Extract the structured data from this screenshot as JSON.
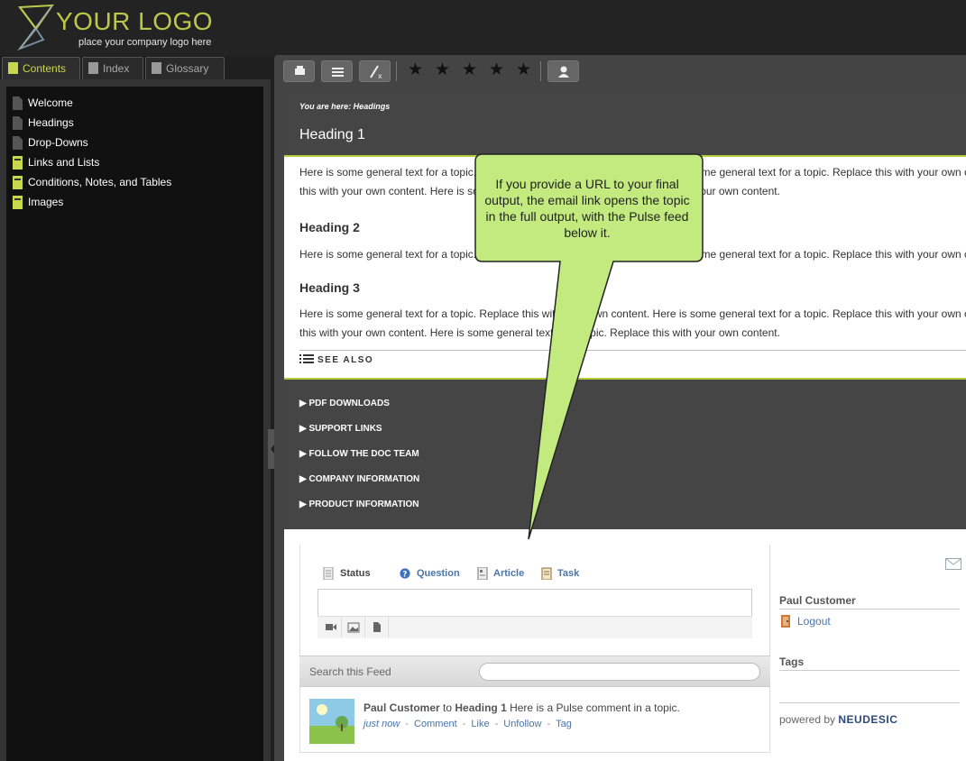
{
  "logo": {
    "text": "YOUR LOGO",
    "tagline": "place your company logo here"
  },
  "nav_tabs": [
    {
      "label": "Contents",
      "active": true
    },
    {
      "label": "Index",
      "active": false
    },
    {
      "label": "Glossary",
      "active": false
    }
  ],
  "toc": [
    {
      "label": "Welcome",
      "icon": "page-icon"
    },
    {
      "label": "Headings",
      "icon": "page-icon"
    },
    {
      "label": "Drop-Downs",
      "icon": "page-icon"
    },
    {
      "label": "Links and Lists",
      "icon": "book-icon"
    },
    {
      "label": "Conditions, Notes, and Tables",
      "icon": "book-icon"
    },
    {
      "label": "Images",
      "icon": "book-icon"
    }
  ],
  "toolbar": {
    "buttons": [
      "print-icon",
      "list-icon",
      "remove-highlight-icon"
    ],
    "rating_stars": 5,
    "user_button": "user-icon"
  },
  "topic": {
    "breadcrumb": "You are here: Headings",
    "h1": "Heading 1",
    "p1_line1": "Here is some general text for a topic. Replace this with your own content. Here is some general text for a topic. Replace this with your own content.",
    "p1_line2": "this with your own content. Here is some general text for a topic. Replace this with your own content.",
    "h2": "Heading 2",
    "p2_line1": "Here is some general text for a topic. Replace this with your own content. Here is some general text for a topic. Replace this with your own content. Here is some general",
    "h3": "Heading 3",
    "p3_line1": "Here is some general text for a topic. Replace this with your own content. Here is some general text for a topic. Replace this with your own content.",
    "p3_line2": "this with your own content. Here is some general text for a topic. Replace this with your own content.",
    "see_also": "SEE ALSO"
  },
  "footer_sections": [
    "PDF DOWNLOADS",
    "SUPPORT LINKS",
    "FOLLOW THE DOC TEAM",
    "COMPANY INFORMATION",
    "PRODUCT INFORMATION"
  ],
  "pulse": {
    "tabs": {
      "status": "Status",
      "question": "Question",
      "article": "Article",
      "task": "Task"
    },
    "search_label": "Search this Feed",
    "search_value": "",
    "comment": {
      "user": "Paul Customer",
      "to": "to",
      "target": "Heading 1",
      "text": "Here is a Pulse comment in a topic."
    },
    "actions": {
      "time": "just now",
      "comment": "Comment",
      "like": "Like",
      "unfollow": "Unfollow",
      "tag": "Tag"
    },
    "user": {
      "name": "Paul Customer",
      "logout": "Logout"
    },
    "tags_label": "Tags",
    "powered_by": "powered by",
    "powered_brand": "NEUDESIC"
  },
  "callout": {
    "text": "If you provide a URL to your final output, the email link opens the topic in the full output, with the Pulse feed below it."
  },
  "colors": {
    "accent": "#b6cb3a",
    "callout_fill": "#c2ea7f",
    "link": "#4b75a8",
    "dark": "#454545"
  }
}
